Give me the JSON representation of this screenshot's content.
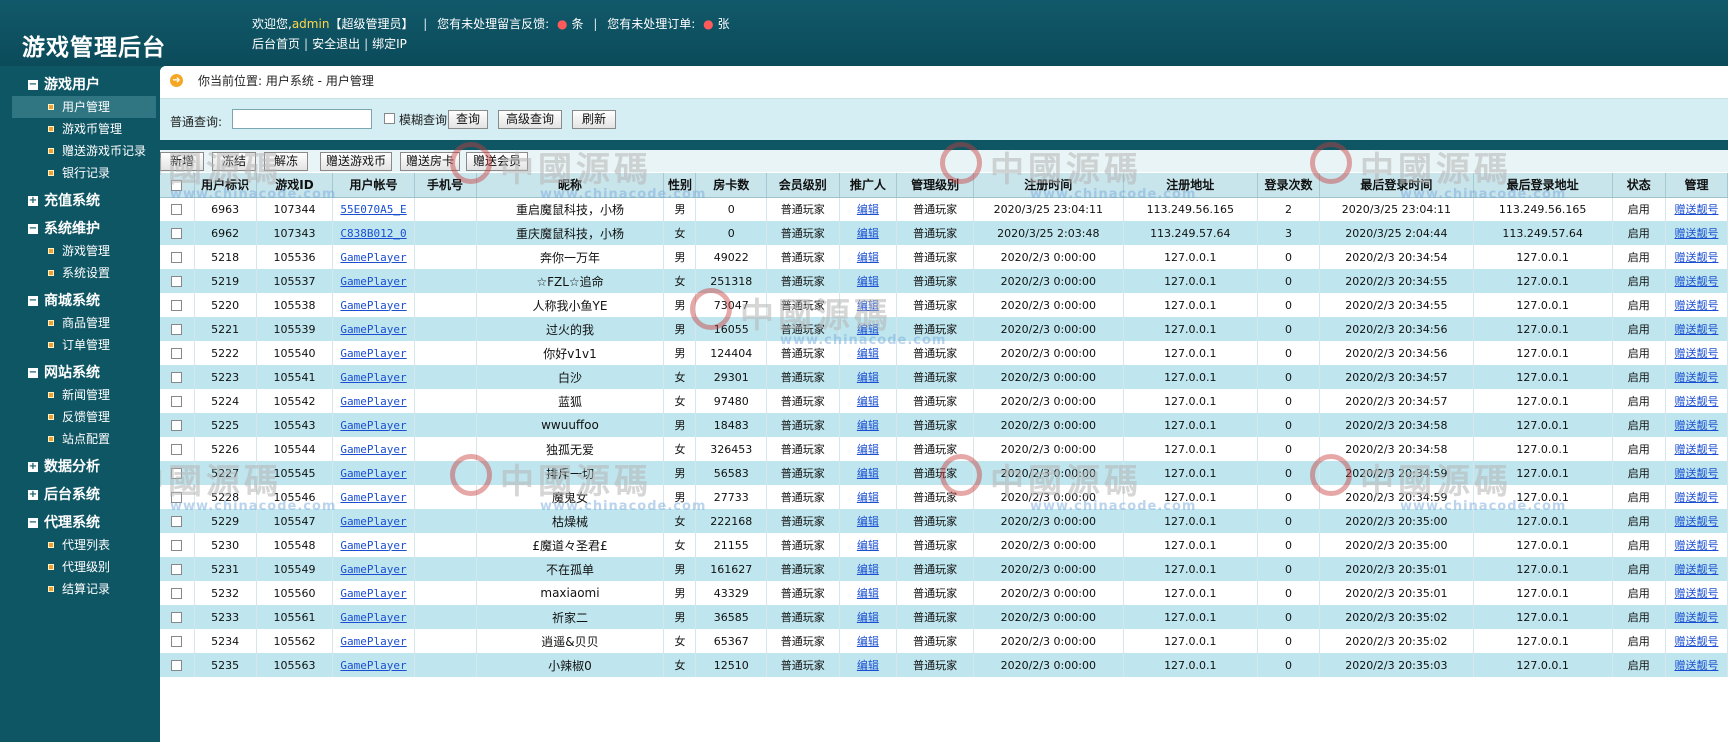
{
  "header": {
    "app_title": "游戏管理后台",
    "welcome_prefix": "欢迎您,",
    "user": "admin",
    "role": "【超级管理员】",
    "feedback_text": "您有未处理留言反馈:",
    "feedback_unit": "条",
    "orders_text": "您有未处理订单:",
    "orders_unit": "张",
    "links": [
      "后台首页",
      "安全退出",
      "绑定IP"
    ]
  },
  "sidebar": {
    "groups": [
      {
        "label": "游戏用户",
        "open": true,
        "items": [
          "用户管理",
          "游戏币管理",
          "赠送游戏币记录",
          "银行记录"
        ]
      },
      {
        "label": "充值系统",
        "open": false,
        "items": []
      },
      {
        "label": "系统维护",
        "open": true,
        "items": [
          "游戏管理",
          "系统设置"
        ]
      },
      {
        "label": "商城系统",
        "open": true,
        "items": [
          "商品管理",
          "订单管理"
        ]
      },
      {
        "label": "网站系统",
        "open": true,
        "items": [
          "新闻管理",
          "反馈管理",
          "站点配置"
        ]
      },
      {
        "label": "数据分析",
        "open": false,
        "items": []
      },
      {
        "label": "后台系统",
        "open": false,
        "items": []
      },
      {
        "label": "代理系统",
        "open": true,
        "items": [
          "代理列表",
          "代理级别",
          "结算记录"
        ]
      }
    ],
    "active_item": "用户管理"
  },
  "location": {
    "text": "你当前位置: 用户系统 - 用户管理"
  },
  "search": {
    "label": "普通查询:",
    "value": "",
    "fuzzy_label": "模糊查询",
    "query_btn": "查询",
    "advanced_btn": "高级查询",
    "refresh_btn": "刷新"
  },
  "actions": [
    "新增",
    "冻结",
    "解冻",
    "赠送游戏币",
    "赠送房卡",
    "赠送会员"
  ],
  "table": {
    "columns": [
      "",
      "用户标识",
      "游戏ID",
      "用户帐号",
      "手机号",
      "昵称",
      "性别",
      "房卡数",
      "会员级别",
      "推广人",
      "管理级别",
      "注册时间",
      "注册地址",
      "登录次数",
      "最后登录时间",
      "最后登录地址",
      "状态",
      "管理"
    ],
    "rows": [
      [
        "6963",
        "107344",
        "55E070A5_E",
        "",
        "重启魔鼠科技，小杨",
        "男",
        "0",
        "普通玩家",
        "编辑",
        "普通玩家",
        "2020/3/25 23:04:11",
        "113.249.56.165",
        "2",
        "2020/3/25 23:04:11",
        "113.249.56.165",
        "启用",
        "赠送靓号"
      ],
      [
        "6962",
        "107343",
        "C838B012_0",
        "",
        "重庆魔鼠科技，小杨",
        "女",
        "0",
        "普通玩家",
        "编辑",
        "普通玩家",
        "2020/3/25 2:03:48",
        "113.249.57.64",
        "3",
        "2020/3/25 2:04:44",
        "113.249.57.64",
        "启用",
        "赠送靓号"
      ],
      [
        "5218",
        "105536",
        "GamePlayer",
        "",
        "奔你一万年",
        "男",
        "49022",
        "普通玩家",
        "编辑",
        "普通玩家",
        "2020/2/3 0:00:00",
        "127.0.0.1",
        "0",
        "2020/2/3 20:34:54",
        "127.0.0.1",
        "启用",
        "赠送靓号"
      ],
      [
        "5219",
        "105537",
        "GamePlayer",
        "",
        "☆FZL☆追命",
        "女",
        "251318",
        "普通玩家",
        "编辑",
        "普通玩家",
        "2020/2/3 0:00:00",
        "127.0.0.1",
        "0",
        "2020/2/3 20:34:55",
        "127.0.0.1",
        "启用",
        "赠送靓号"
      ],
      [
        "5220",
        "105538",
        "GamePlayer",
        "",
        "人称我小鱼YE",
        "男",
        "73047",
        "普通玩家",
        "编辑",
        "普通玩家",
        "2020/2/3 0:00:00",
        "127.0.0.1",
        "0",
        "2020/2/3 20:34:55",
        "127.0.0.1",
        "启用",
        "赠送靓号"
      ],
      [
        "5221",
        "105539",
        "GamePlayer",
        "",
        "过火的我",
        "男",
        "16055",
        "普通玩家",
        "编辑",
        "普通玩家",
        "2020/2/3 0:00:00",
        "127.0.0.1",
        "0",
        "2020/2/3 20:34:56",
        "127.0.0.1",
        "启用",
        "赠送靓号"
      ],
      [
        "5222",
        "105540",
        "GamePlayer",
        "",
        "你好v1v1",
        "男",
        "124404",
        "普通玩家",
        "编辑",
        "普通玩家",
        "2020/2/3 0:00:00",
        "127.0.0.1",
        "0",
        "2020/2/3 20:34:56",
        "127.0.0.1",
        "启用",
        "赠送靓号"
      ],
      [
        "5223",
        "105541",
        "GamePlayer",
        "",
        "白沙",
        "女",
        "29301",
        "普通玩家",
        "编辑",
        "普通玩家",
        "2020/2/3 0:00:00",
        "127.0.0.1",
        "0",
        "2020/2/3 20:34:57",
        "127.0.0.1",
        "启用",
        "赠送靓号"
      ],
      [
        "5224",
        "105542",
        "GamePlayer",
        "",
        "蓝狐",
        "女",
        "97480",
        "普通玩家",
        "编辑",
        "普通玩家",
        "2020/2/3 0:00:00",
        "127.0.0.1",
        "0",
        "2020/2/3 20:34:57",
        "127.0.0.1",
        "启用",
        "赠送靓号"
      ],
      [
        "5225",
        "105543",
        "GamePlayer",
        "",
        "wwuuffoo",
        "男",
        "18483",
        "普通玩家",
        "编辑",
        "普通玩家",
        "2020/2/3 0:00:00",
        "127.0.0.1",
        "0",
        "2020/2/3 20:34:58",
        "127.0.0.1",
        "启用",
        "赠送靓号"
      ],
      [
        "5226",
        "105544",
        "GamePlayer",
        "",
        "独孤无爱",
        "女",
        "326453",
        "普通玩家",
        "编辑",
        "普通玩家",
        "2020/2/3 0:00:00",
        "127.0.0.1",
        "0",
        "2020/2/3 20:34:58",
        "127.0.0.1",
        "启用",
        "赠送靓号"
      ],
      [
        "5227",
        "105545",
        "GamePlayer",
        "",
        "排斥一切",
        "男",
        "56583",
        "普通玩家",
        "编辑",
        "普通玩家",
        "2020/2/3 0:00:00",
        "127.0.0.1",
        "0",
        "2020/2/3 20:34:59",
        "127.0.0.1",
        "启用",
        "赠送靓号"
      ],
      [
        "5228",
        "105546",
        "GamePlayer",
        "",
        "魔鬼女",
        "男",
        "27733",
        "普通玩家",
        "编辑",
        "普通玩家",
        "2020/2/3 0:00:00",
        "127.0.0.1",
        "0",
        "2020/2/3 20:34:59",
        "127.0.0.1",
        "启用",
        "赠送靓号"
      ],
      [
        "5229",
        "105547",
        "GamePlayer",
        "",
        "枯燥械",
        "女",
        "222168",
        "普通玩家",
        "编辑",
        "普通玩家",
        "2020/2/3 0:00:00",
        "127.0.0.1",
        "0",
        "2020/2/3 20:35:00",
        "127.0.0.1",
        "启用",
        "赠送靓号"
      ],
      [
        "5230",
        "105548",
        "GamePlayer",
        "",
        "£魔道々圣君£",
        "女",
        "21155",
        "普通玩家",
        "编辑",
        "普通玩家",
        "2020/2/3 0:00:00",
        "127.0.0.1",
        "0",
        "2020/2/3 20:35:00",
        "127.0.0.1",
        "启用",
        "赠送靓号"
      ],
      [
        "5231",
        "105549",
        "GamePlayer",
        "",
        "不在孤单",
        "男",
        "161627",
        "普通玩家",
        "编辑",
        "普通玩家",
        "2020/2/3 0:00:00",
        "127.0.0.1",
        "0",
        "2020/2/3 20:35:01",
        "127.0.0.1",
        "启用",
        "赠送靓号"
      ],
      [
        "5232",
        "105560",
        "GamePlayer",
        "",
        "maxiaomi",
        "男",
        "43329",
        "普通玩家",
        "编辑",
        "普通玩家",
        "2020/2/3 0:00:00",
        "127.0.0.1",
        "0",
        "2020/2/3 20:35:01",
        "127.0.0.1",
        "启用",
        "赠送靓号"
      ],
      [
        "5233",
        "105561",
        "GamePlayer",
        "",
        "祈家二",
        "男",
        "36585",
        "普通玩家",
        "编辑",
        "普通玩家",
        "2020/2/3 0:00:00",
        "127.0.0.1",
        "0",
        "2020/2/3 20:35:02",
        "127.0.0.1",
        "启用",
        "赠送靓号"
      ],
      [
        "5234",
        "105562",
        "GamePlayer",
        "",
        "逍遥&贝贝",
        "女",
        "65367",
        "普通玩家",
        "编辑",
        "普通玩家",
        "2020/2/3 0:00:00",
        "127.0.0.1",
        "0",
        "2020/2/3 20:35:02",
        "127.0.0.1",
        "启用",
        "赠送靓号"
      ],
      [
        "5235",
        "105563",
        "GamePlayer",
        "",
        "小辣椒0",
        "女",
        "12510",
        "普通玩家",
        "编辑",
        "普通玩家",
        "2020/2/3 0:00:00",
        "127.0.0.1",
        "0",
        "2020/2/3 20:35:03",
        "127.0.0.1",
        "启用",
        "赠送靓号"
      ]
    ]
  },
  "watermark": {
    "text": "中國源碼",
    "sub": "www.chinacode.com"
  },
  "colors": {
    "sidebar_bg": "#0f5664",
    "row_alt": "#bfe6ee",
    "link": "#1a4fd1",
    "bullet": "#f0a030"
  }
}
